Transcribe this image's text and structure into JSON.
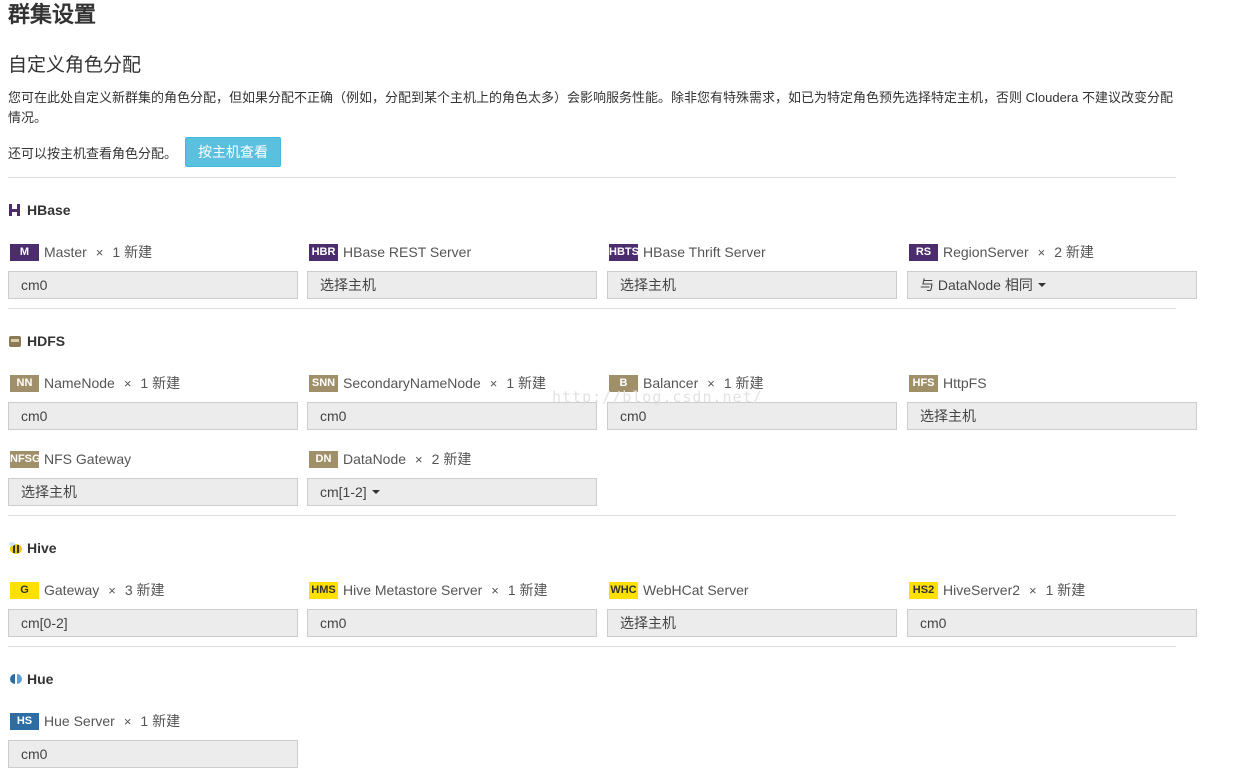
{
  "page_title": "群集设置",
  "section_title": "自定义角色分配",
  "description": "您可在此处自定义新群集的角色分配，但如果分配不正确（例如，分配到某个主机上的角色太多）会影响服务性能。除非您有特殊需求，如已为特定角色预先选择特定主机，否则 Cloudera 不建议改变分配情况。",
  "view_by_host_text": "还可以按主机查看角色分配。",
  "view_by_host_button": "按主机查看",
  "watermark": "http://blog.csdn.net/",
  "colors": {
    "hbase": "#4b2d6e",
    "hdfs": "#a0906a",
    "hive": "#ffe000",
    "hue": "#2e6da4",
    "button": "#5bc0de"
  },
  "services": {
    "hbase": {
      "name": "HBase",
      "icon": "hbase-icon",
      "roles": [
        {
          "badge": "M",
          "name": "Master",
          "times": "×",
          "count": "1 新建",
          "value": "cm0"
        },
        {
          "badge": "HBR",
          "name": "HBase REST Server",
          "times": "",
          "count": "",
          "value": "选择主机"
        },
        {
          "badge": "HBTS",
          "name": "HBase Thrift Server",
          "times": "",
          "count": "",
          "value": "选择主机"
        },
        {
          "badge": "RS",
          "name": "RegionServer",
          "times": "×",
          "count": "2 新建",
          "value": "与 DataNode 相同"
        }
      ]
    },
    "hdfs": {
      "name": "HDFS",
      "icon": "hdfs-icon",
      "roles": [
        {
          "badge": "NN",
          "name": "NameNode",
          "times": "×",
          "count": "1 新建",
          "value": "cm0"
        },
        {
          "badge": "SNN",
          "name": "SecondaryNameNode",
          "times": "×",
          "count": "1 新建",
          "value": "cm0"
        },
        {
          "badge": "B",
          "name": "Balancer",
          "times": "×",
          "count": "1 新建",
          "value": "cm0"
        },
        {
          "badge": "HFS",
          "name": "HttpFS",
          "times": "",
          "count": "",
          "value": "选择主机"
        },
        {
          "badge": "NFSG",
          "name": "NFS Gateway",
          "times": "",
          "count": "",
          "value": "选择主机"
        },
        {
          "badge": "DN",
          "name": "DataNode",
          "times": "×",
          "count": "2 新建",
          "value": "cm[1-2]"
        }
      ]
    },
    "hive": {
      "name": "Hive",
      "icon": "hive-bee-icon",
      "roles": [
        {
          "badge": "G",
          "name": "Gateway",
          "times": "×",
          "count": "3 新建",
          "value": "cm[0-2]"
        },
        {
          "badge": "HMS",
          "name": "Hive Metastore Server",
          "times": "×",
          "count": "1 新建",
          "value": "cm0"
        },
        {
          "badge": "WHC",
          "name": "WebHCat Server",
          "times": "",
          "count": "",
          "value": "选择主机"
        },
        {
          "badge": "HS2",
          "name": "HiveServer2",
          "times": "×",
          "count": "1 新建",
          "value": "cm0"
        }
      ]
    },
    "hue": {
      "name": "Hue",
      "icon": "hue-icon",
      "roles": [
        {
          "badge": "HS",
          "name": "Hue Server",
          "times": "×",
          "count": "1 新建",
          "value": "cm0"
        }
      ]
    }
  }
}
